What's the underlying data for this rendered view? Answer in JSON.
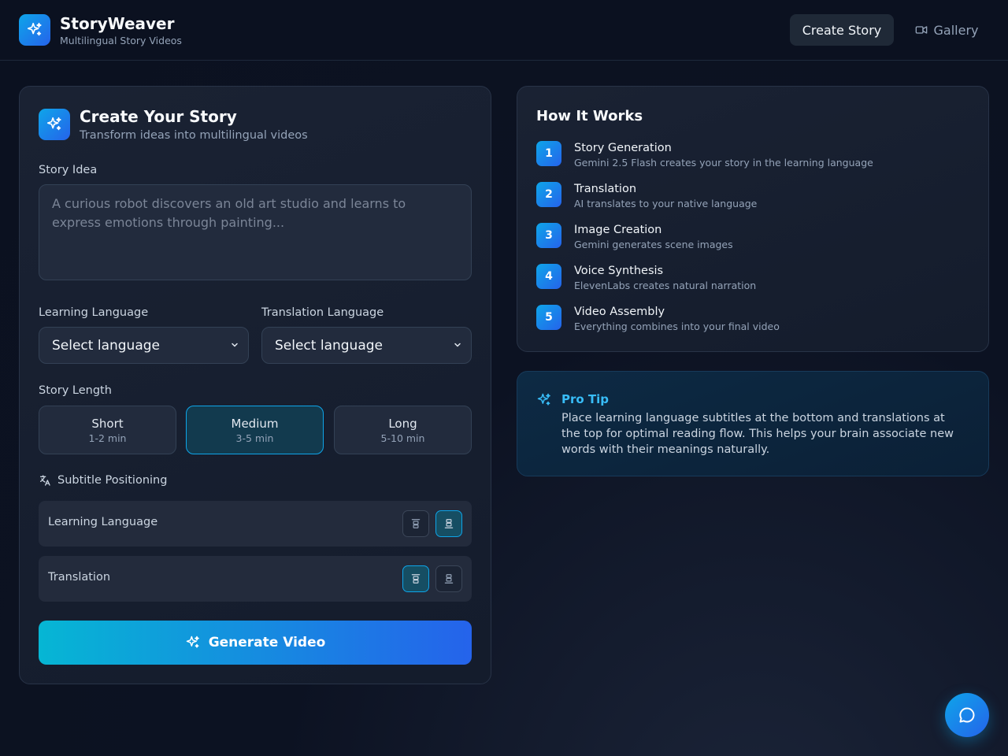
{
  "header": {
    "brand_title": "StoryWeaver",
    "brand_subtitle": "Multilingual Story Videos",
    "nav_create": "Create Story",
    "nav_gallery": "Gallery"
  },
  "create": {
    "title": "Create Your Story",
    "subtitle": "Transform ideas into multilingual videos",
    "idea_label": "Story Idea",
    "idea_value": "",
    "idea_placeholder": "A curious robot discovers an old art studio and learns to express emotions through painting...",
    "learning_label": "Learning Language",
    "learning_selected": "Select language",
    "translation_label": "Translation Language",
    "translation_selected": "Select language",
    "length_label": "Story Length",
    "lengths": [
      {
        "title": "Short",
        "sub": "1-2 min",
        "active": false
      },
      {
        "title": "Medium",
        "sub": "3-5 min",
        "active": true
      },
      {
        "title": "Long",
        "sub": "5-10 min",
        "active": false
      }
    ],
    "subtitle_positioning_label": "Subtitle Positioning",
    "rows": [
      {
        "label": "Learning Language",
        "selected": "bottom"
      },
      {
        "label": "Translation",
        "selected": "top"
      }
    ],
    "generate_label": "Generate Video"
  },
  "how": {
    "title": "How It Works",
    "steps": [
      {
        "num": "1",
        "title": "Story Generation",
        "desc": "Gemini 2.5 Flash creates your story in the learning language"
      },
      {
        "num": "2",
        "title": "Translation",
        "desc": "AI translates to your native language"
      },
      {
        "num": "3",
        "title": "Image Creation",
        "desc": "Gemini generates scene images"
      },
      {
        "num": "4",
        "title": "Voice Synthesis",
        "desc": "ElevenLabs creates natural narration"
      },
      {
        "num": "5",
        "title": "Video Assembly",
        "desc": "Everything combines into your final video"
      }
    ]
  },
  "tip": {
    "title": "Pro Tip",
    "text": "Place learning language subtitles at the bottom and translations at the top for optimal reading flow. This helps your brain associate new words with their meanings naturally."
  },
  "colors": {
    "accent": "#0ea5e9",
    "accent_deep": "#2563eb",
    "background": "#0b1120"
  },
  "icons": {
    "brand": "sparkles-icon",
    "gallery": "video-camera-icon",
    "subtitle_positioning": "translate-icon",
    "position_top": "align-top-icon",
    "position_bottom": "align-bottom-icon",
    "chat": "chat-bubble-icon"
  }
}
